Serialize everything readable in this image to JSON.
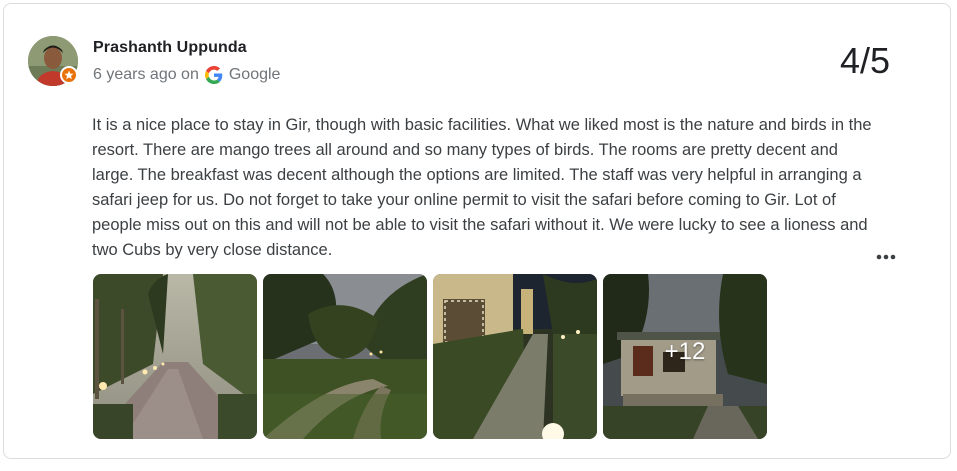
{
  "review": {
    "reviewer_name": "Prashanth Uppunda",
    "time_ago": "6 years ago on",
    "source": "Google",
    "rating": "4/5",
    "text": "It is a nice place to stay in Gir, though with basic facilities. What we liked most is the nature and birds in the resort. There are mango trees all around and so many types of birds. The rooms are pretty decent and large. The breakfast was decent although the options are limited. The staff was very helpful in arranging a safari jeep for us. Do not forget to take your online permit to visit the safari before coming to Gir. Lot of people miss out on this and will not be able to visit the safari without it. We were lucky to see a lioness and two Cubs by very close distance.",
    "more_photos_count": "+12"
  },
  "icons": {
    "avatar": "avatar-photo",
    "badge": "local-guide-badge-icon",
    "source": "google-logo-icon",
    "menu": "more-options-icon"
  },
  "colors": {
    "badge": "#e8710a",
    "name": "#202124",
    "meta": "#70757a",
    "body_text": "#3c4043"
  }
}
